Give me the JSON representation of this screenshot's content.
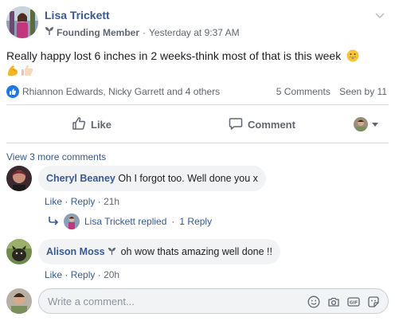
{
  "post": {
    "author": "Lisa Trickett",
    "badge_label": "Founding Member",
    "separator": "·",
    "timestamp": "Yesterday at 9:37 AM",
    "text": "Really happy lost 6 inches in 2 weeks-think most of that is this week",
    "emojis": [
      "grinning-face",
      "flexed-biceps",
      "thumbs-up"
    ]
  },
  "reactions": {
    "reactor_summary": "Rhiannon Edwards, Nicky Garrett and 4 others",
    "comments_count": "5 Comments",
    "seen_by": "Seen by 11"
  },
  "actions": {
    "like_label": "Like",
    "comment_label": "Comment"
  },
  "comments_section": {
    "view_more": "View 3 more comments",
    "comments": [
      {
        "author": "Cheryl Beaney",
        "text": "Oh I forgot too. Well done you x",
        "like": "Like",
        "reply": "Reply",
        "dot": "·",
        "time": "21h"
      },
      {
        "author": "Alison Moss",
        "text": "oh wow thats amazing well done !!",
        "like": "Like",
        "reply": "Reply",
        "dot": "·",
        "time": "20h"
      }
    ],
    "reply_thread": {
      "text": "Lisa Trickett replied",
      "dot": "·",
      "count": "1 Reply"
    }
  },
  "composer": {
    "placeholder": "Write a comment..."
  },
  "colors": {
    "link_blue": "#385898",
    "like_blue": "#1877f2",
    "meta_gray": "#606770",
    "bubble_bg": "#f2f3f5"
  }
}
